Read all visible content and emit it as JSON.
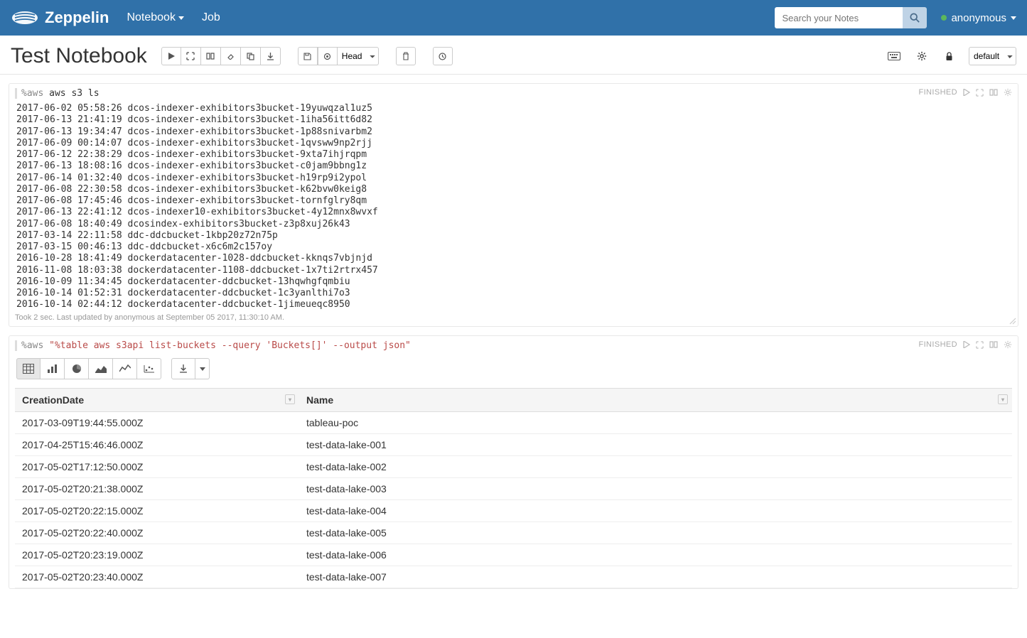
{
  "navbar": {
    "brand": "Zeppelin",
    "links": {
      "notebook": "Notebook",
      "job": "Job"
    },
    "search_placeholder": "Search your Notes",
    "user": "anonymous"
  },
  "title": "Test Notebook",
  "toolbar": {
    "head_label": "Head",
    "mode_label": "default"
  },
  "paragraph1": {
    "interpreter": "%aws",
    "command": "aws s3 ls",
    "status": "FINISHED",
    "footer": "Took 2 sec. Last updated by anonymous at September 05 2017, 11:30:10 AM.",
    "output_lines": [
      "2017-06-02 05:58:26 dcos-indexer-exhibitors3bucket-19yuwqzal1uz5",
      "2017-06-13 21:41:19 dcos-indexer-exhibitors3bucket-1iha56itt6d82",
      "2017-06-13 19:34:47 dcos-indexer-exhibitors3bucket-1p88snivarbm2",
      "2017-06-09 00:14:07 dcos-indexer-exhibitors3bucket-1qvsww9np2rjj",
      "2017-06-12 22:38:29 dcos-indexer-exhibitors3bucket-9xta7ihjrqpm",
      "2017-06-13 18:08:16 dcos-indexer-exhibitors3bucket-c0jam9bbng1z",
      "2017-06-14 01:32:40 dcos-indexer-exhibitors3bucket-h19rp9i2ypol",
      "2017-06-08 22:30:58 dcos-indexer-exhibitors3bucket-k62bvw0keig8",
      "2017-06-08 17:45:46 dcos-indexer-exhibitors3bucket-tornfglry8qm",
      "2017-06-13 22:41:12 dcos-indexer10-exhibitors3bucket-4y12mnx8wvxf",
      "2017-06-08 18:40:49 dcosindex-exhibitors3bucket-z3p8xuj26k43",
      "2017-03-14 22:11:58 ddc-ddcbucket-1kbp20z72n75p",
      "2017-03-15 00:46:13 ddc-ddcbucket-x6c6m2c157oy",
      "2016-10-28 18:41:49 dockerdatacenter-1028-ddcbucket-kknqs7vbjnjd",
      "2016-11-08 18:03:38 dockerdatacenter-1108-ddcbucket-1x7ti2rtrx457",
      "2016-10-09 11:34:45 dockerdatacenter-ddcbucket-13hqwhgfqmbiu",
      "2016-10-14 01:52:31 dockerdatacenter-ddcbucket-1c3yanlthi7o3",
      "2016-10-14 02:44:12 dockerdatacenter-ddcbucket-1jimeueqc8950"
    ]
  },
  "paragraph2": {
    "interpreter": "%aws",
    "command": "\"%table aws s3api list-buckets --query 'Buckets[]' --output json\"",
    "status": "FINISHED",
    "columns": [
      "CreationDate",
      "Name"
    ],
    "rows": [
      [
        "2017-03-09T19:44:55.000Z",
        "tableau-poc"
      ],
      [
        "2017-04-25T15:46:46.000Z",
        "test-data-lake-001"
      ],
      [
        "2017-05-02T17:12:50.000Z",
        "test-data-lake-002"
      ],
      [
        "2017-05-02T20:21:38.000Z",
        "test-data-lake-003"
      ],
      [
        "2017-05-02T20:22:15.000Z",
        "test-data-lake-004"
      ],
      [
        "2017-05-02T20:22:40.000Z",
        "test-data-lake-005"
      ],
      [
        "2017-05-02T20:23:19.000Z",
        "test-data-lake-006"
      ],
      [
        "2017-05-02T20:23:40.000Z",
        "test-data-lake-007"
      ]
    ]
  }
}
